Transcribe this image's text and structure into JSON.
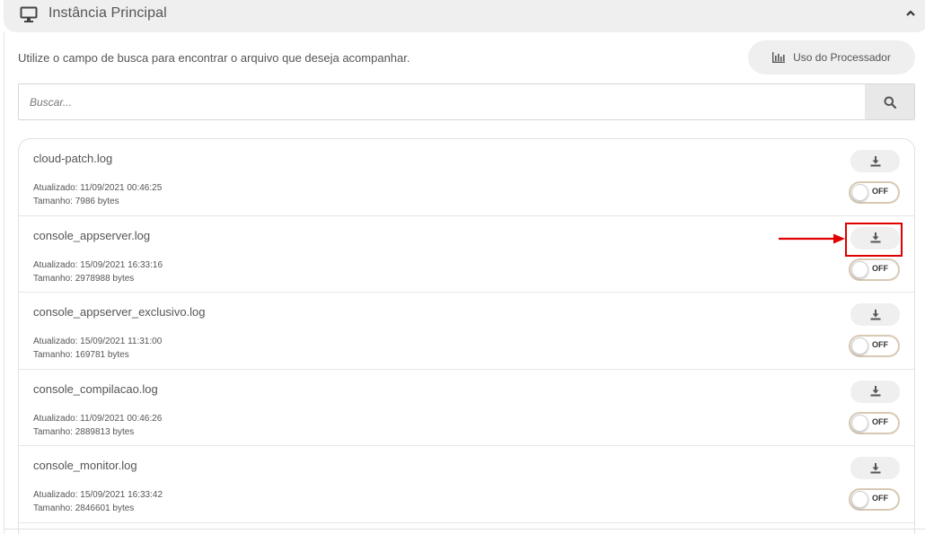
{
  "panel": {
    "title": "Instância Principal",
    "help_text": "Utilize o campo de busca para encontrar o arquivo que deseja acompanhar.",
    "processor_button_label": "Uso do Processador"
  },
  "search": {
    "placeholder": "Buscar...",
    "value": ""
  },
  "files": [
    {
      "name": "cloud-patch.log",
      "updated": "Atualizado: 11/09/2021 00:46:25",
      "size": "Tamanho: 7986 bytes",
      "toggle": "OFF"
    },
    {
      "name": "console_appserver.log",
      "updated": "Atualizado: 15/09/2021 16:33:16",
      "size": "Tamanho: 2978988 bytes",
      "toggle": "OFF"
    },
    {
      "name": "console_appserver_exclusivo.log",
      "updated": "Atualizado: 15/09/2021 11:31:00",
      "size": "Tamanho: 169781 bytes",
      "toggle": "OFF"
    },
    {
      "name": "console_compilacao.log",
      "updated": "Atualizado: 11/09/2021 00:46:26",
      "size": "Tamanho: 2889813 bytes",
      "toggle": "OFF"
    },
    {
      "name": "console_monitor.log",
      "updated": "Atualizado: 15/09/2021 16:33:42",
      "size": "Tamanho: 2846601 bytes",
      "toggle": "OFF"
    }
  ],
  "icons": {
    "header": "monitor-icon",
    "collapse": "chevron-up-icon",
    "processor": "bar-chart-icon",
    "search": "search-icon",
    "download": "download-icon"
  },
  "colors": {
    "highlight": "#e00000",
    "toggle_border": "#d8c9b5",
    "button_bg": "#efefef"
  }
}
